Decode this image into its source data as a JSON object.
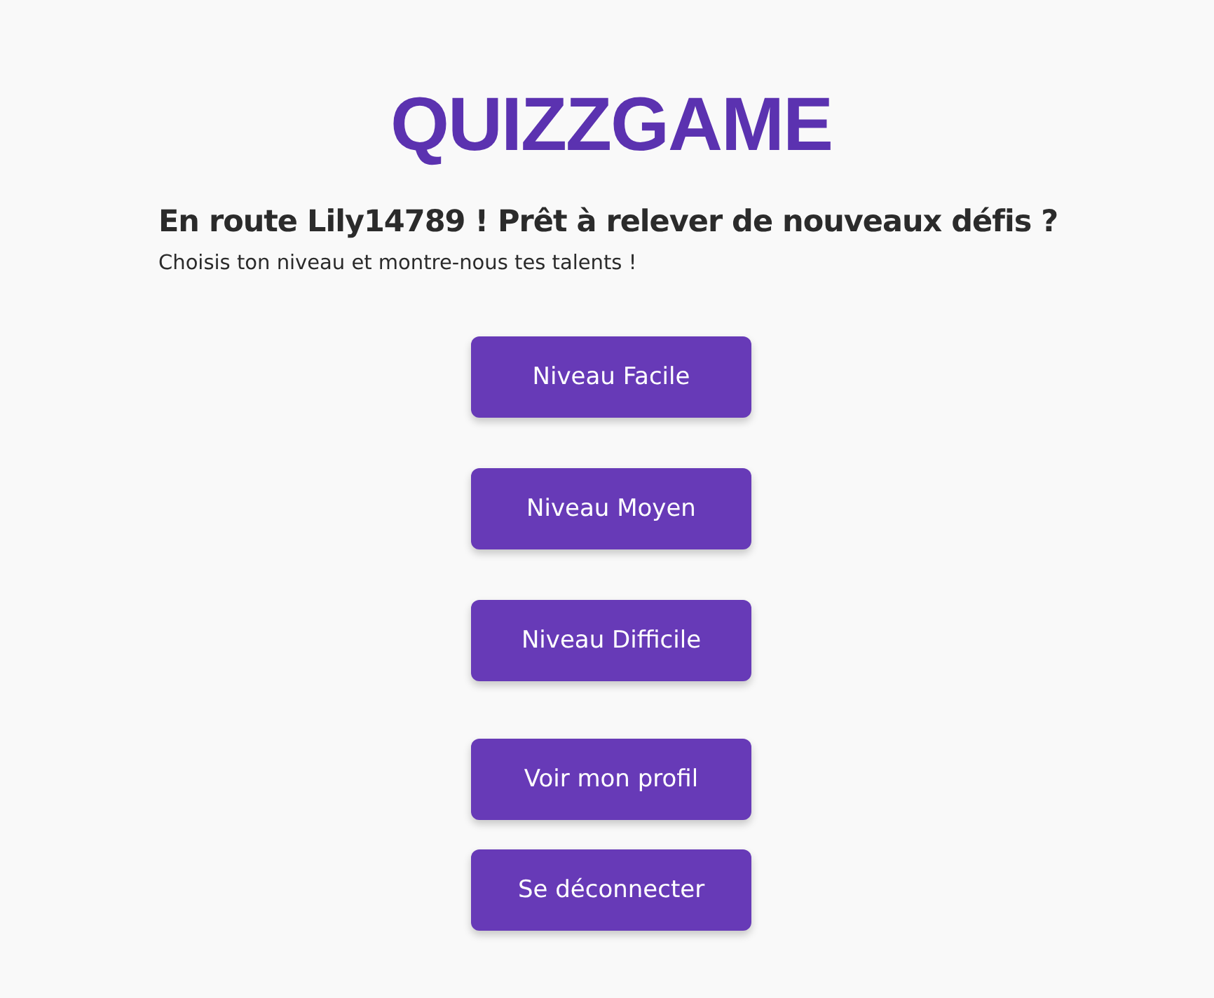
{
  "logo": "QUIZZGAME",
  "greeting": "En route Lily14789 ! Prêt à relever de nouveaux défis ?",
  "subtitle": "Choisis ton niveau et montre-nous tes talents !",
  "level_buttons": [
    "Niveau Facile",
    "Niveau Moyen",
    "Niveau Difficile"
  ],
  "account_buttons": [
    "Voir mon profil",
    "Se déconnecter"
  ]
}
